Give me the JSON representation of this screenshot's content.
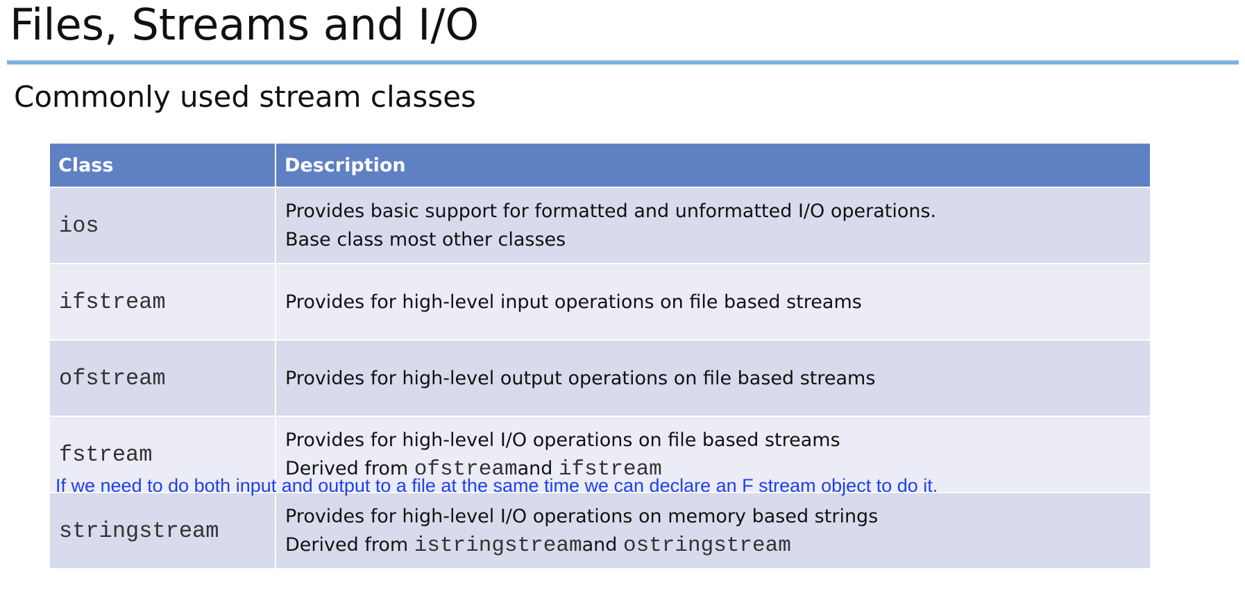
{
  "slide": {
    "title": "Files, Streams and I/O",
    "subtitle": "Commonly used stream classes",
    "accent_rule_color": "#7fb1e3",
    "header_color": "#5f80c3",
    "row_colors": [
      "#d7dbec",
      "#ebecf6"
    ]
  },
  "table": {
    "headers": [
      "Class",
      "Description"
    ],
    "rows": [
      {
        "cls": "ios",
        "line1": "Provides basic support for formatted and unformatted I/O operations.",
        "line2": "Base class most other classes"
      },
      {
        "cls": "ifstream",
        "line1": "Provides for high-level input operations on file based streams"
      },
      {
        "cls": "ofstream",
        "line1": "Provides for high-level output operations on file based streams"
      },
      {
        "cls": "fstream",
        "line1": "Provides for high-level I/O operations on file based streams",
        "line2_prefix": "Derived from ",
        "line2_code1": "ofstream",
        "line2_mid": "and ",
        "line2_code2": "ifstream"
      },
      {
        "cls": "stringstream",
        "line1": "Provides for high-level I/O operations on memory based strings",
        "line2_prefix": "Derived from ",
        "line2_code1": "istringstream",
        "line2_mid": "and ",
        "line2_code2": "ostringstream"
      }
    ]
  },
  "caption": {
    "text": "If we need to do both input and output to a file at the same time we can declare an F stream object to do it.",
    "color": "#1e3ff0"
  }
}
